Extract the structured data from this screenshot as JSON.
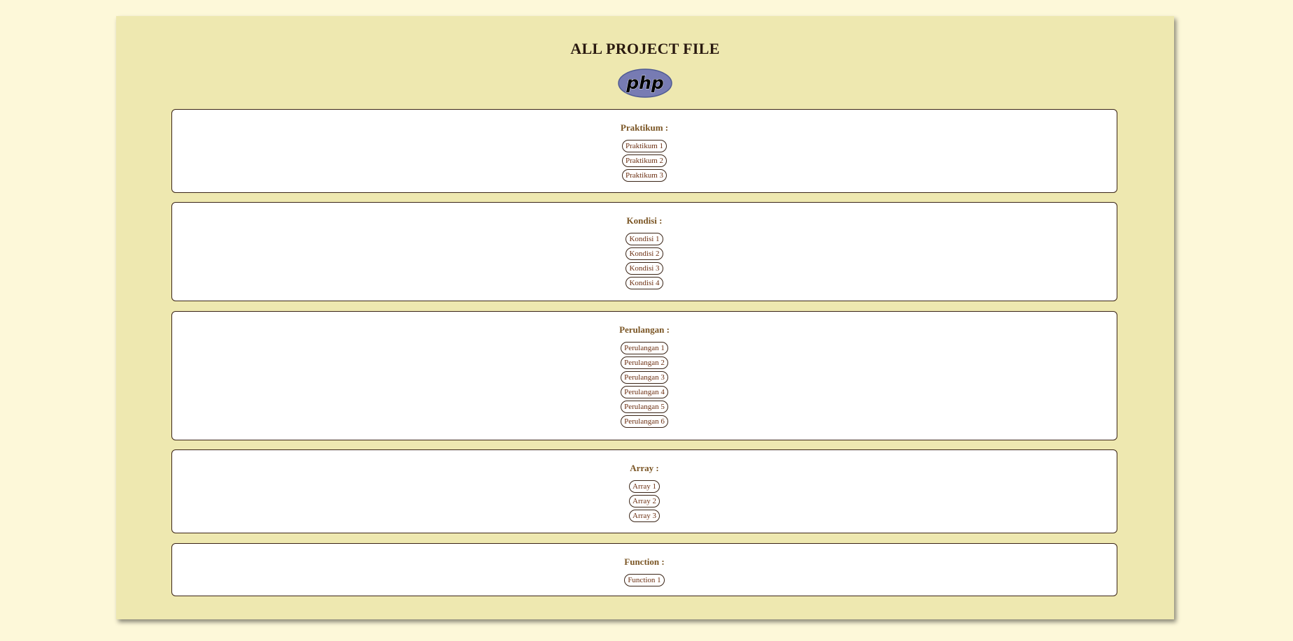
{
  "page": {
    "title": "ALL PROJECT FILE",
    "logo_text": "php"
  },
  "sections": [
    {
      "title": "Praktikum :",
      "links": [
        "Praktikum 1",
        "Praktikum 2",
        "Praktikum 3"
      ]
    },
    {
      "title": "Kondisi :",
      "links": [
        "Kondisi 1",
        "Kondisi 2",
        "Kondisi 3",
        "Kondisi 4"
      ]
    },
    {
      "title": "Perulangan :",
      "links": [
        "Perulangan 1",
        "Perulangan 2",
        "Perulangan 3",
        "Perulangan 4",
        "Perulangan 5",
        "Perulangan 6"
      ]
    },
    {
      "title": "Array :",
      "links": [
        "Array 1",
        "Array 2",
        "Array 3"
      ]
    },
    {
      "title": "Function :",
      "links": [
        "Function 1"
      ]
    }
  ],
  "colors": {
    "page_bg": "#fdf8d9",
    "container_bg": "#eee8b0",
    "section_title": "#7a5524",
    "link_text": "#6b2e10",
    "logo_fill": "#777bb3"
  }
}
